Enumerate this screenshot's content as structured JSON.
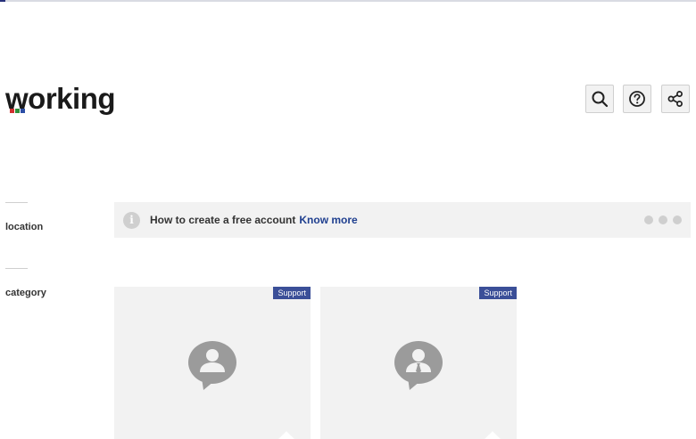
{
  "brand": {
    "logo_text": "working",
    "colors": {
      "dot1": "#d12f2f",
      "dot2": "#2f8f3a",
      "dot3": "#2b4ea5"
    }
  },
  "header": {
    "icons": [
      "search-icon",
      "help-icon",
      "share-icon"
    ]
  },
  "sidebar": {
    "items": [
      {
        "label": "location"
      },
      {
        "label": "category"
      }
    ]
  },
  "banner": {
    "text": "How to create a free account",
    "link": "Know more",
    "icon": "info-icon"
  },
  "cards": [
    {
      "badge": "Support",
      "icon": "support-person-icon"
    },
    {
      "badge": "Support",
      "icon": "support-agent-icon"
    }
  ]
}
